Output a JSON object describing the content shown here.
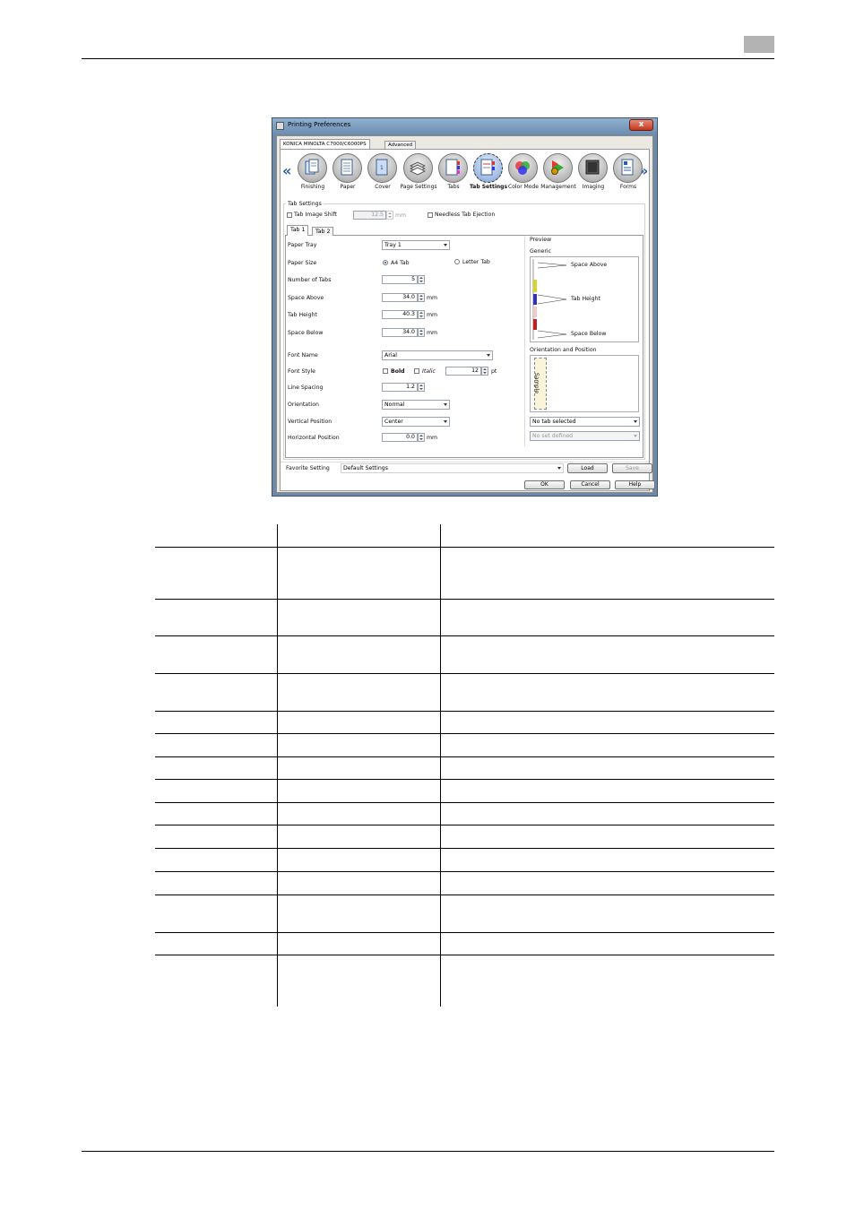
{
  "dialog": {
    "title": "Printing Preferences",
    "close_label": "x",
    "main_tabs": [
      "KONICA MINOLTA C7000/C6000PS",
      "Advanced"
    ],
    "icons": [
      {
        "label": "Finishing",
        "icon": "finishing-icon"
      },
      {
        "label": "Paper",
        "icon": "paper-icon"
      },
      {
        "label": "Cover",
        "icon": "cover-icon"
      },
      {
        "label": "Page Settings",
        "icon": "page-settings-icon"
      },
      {
        "label": "Tabs",
        "icon": "tabs-icon"
      },
      {
        "label": "Tab Settings",
        "icon": "tab-settings-icon",
        "selected": true
      },
      {
        "label": "Color Mode",
        "icon": "color-mode-icon"
      },
      {
        "label": "Management",
        "icon": "management-icon"
      },
      {
        "label": "Imaging",
        "icon": "imaging-icon"
      },
      {
        "label": "Forms",
        "icon": "forms-icon"
      }
    ],
    "nav_prev": "«",
    "nav_next": "»",
    "tab_settings": {
      "group_title": "Tab Settings",
      "tab_image_shift_label": "Tab Image Shift",
      "tab_image_shift_value": "12.5",
      "tab_image_shift_unit": "mm",
      "needless_tab_ejection_label": "Needless Tab Ejection",
      "subtabs": [
        "Tab 1",
        "Tab 2"
      ],
      "rows": {
        "paper_tray_label": "Paper Tray",
        "paper_tray_value": "Tray 1",
        "paper_size_label": "Paper Size",
        "paper_size_a4": "A4 Tab",
        "paper_size_letter": "Letter Tab",
        "number_of_tabs_label": "Number of Tabs",
        "number_of_tabs_value": "5",
        "space_above_label": "Space Above",
        "space_above_value": "34.0",
        "tab_height_label": "Tab Height",
        "tab_height_value": "40.3",
        "space_below_label": "Space Below",
        "space_below_value": "34.0",
        "unit_mm": "mm",
        "font_name_label": "Font Name",
        "font_name_value": "Arial",
        "font_style_label": "Font Style",
        "bold_label": "Bold",
        "italic_label": "Italic",
        "font_size_value": "12",
        "font_size_unit": "pt",
        "line_spacing_label": "Line Spacing",
        "line_spacing_value": "1.2",
        "orientation_label": "Orientation",
        "orientation_value": "Normal",
        "vertical_position_label": "Vertical Position",
        "vertical_position_value": "Center",
        "horizontal_position_label": "Horizontal Position",
        "horizontal_position_value": "0.0"
      },
      "preview": {
        "title": "Preview",
        "generic_label": "Generic",
        "space_above": "Space Above",
        "tab_height": "Tab Height",
        "space_below": "Space Below",
        "orientation_position_label": "Orientation and Position",
        "sample_text": "Sample",
        "tab_select_value": "No tab selected",
        "set_select_value": "No set defined"
      }
    },
    "favorite_label": "Favorite Setting",
    "favorite_value": "Default Settings",
    "load_label": "Load",
    "save_label": "Save",
    "ok_label": "OK",
    "cancel_label": "Cancel",
    "help_label": "Help"
  },
  "colors": {
    "title_bar": "#7f9fc2",
    "nav_arrow": "#2a5db0",
    "close_button": "#c3371e"
  }
}
